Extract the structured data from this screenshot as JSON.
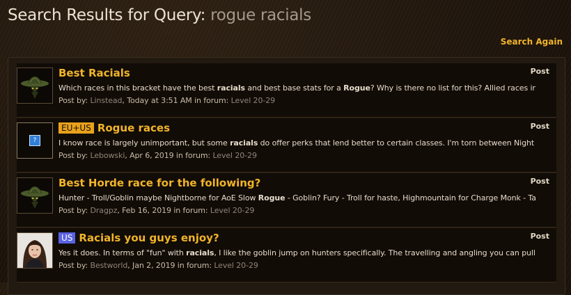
{
  "header": {
    "title_prefix": "Search Results for Query: ",
    "query": "rogue racials",
    "search_again": "Search Again"
  },
  "results": [
    {
      "badge": "",
      "title_part1": "Best ",
      "title_part2": "Racials",
      "type": "Post",
      "snippet": "Which races in this bracket have the best racials and best base stats for a Rogue? Why is there no list for this? Allied races included, horde...",
      "post_by_label": "Post by: ",
      "author": "Linstead",
      "date": ", Today at 3:51 AM in forum: ",
      "forum": "Level 20-29",
      "avatar": "troll-icon"
    },
    {
      "badge": "EU+US",
      "title_part1": "Rogue",
      "title_part2": " races",
      "type": "Post",
      "snippet": "I know race is largely unimportant, but some racials do offer perks that lend better to certain classes. I'm torn between Night Elf for Shadowmeld...",
      "post_by_label": "Post by: ",
      "author": "Lebowski",
      "date": ", Apr 6, 2019 in forum: ",
      "forum": "Level 20-29",
      "avatar": "question-icon"
    },
    {
      "badge": "",
      "title_part1": "Best Horde race for the following?",
      "title_part2": "",
      "type": "Post",
      "snippet": "Hunter - Troll/Goblin maybe Nightborne for AoE Slow Rogue - Goblin? Fury - Troll for haste, Highmountain for Charge Monk - Tauren stomp For all -...",
      "post_by_label": "Post by: ",
      "author": "Dragpz",
      "date": ", Feb 16, 2019 in forum: ",
      "forum": "Level 20-29",
      "avatar": "troll-icon"
    },
    {
      "badge": "US",
      "title_part1": "Racials",
      "title_part2": " you guys enjoy?",
      "type": "Post",
      "snippet": "Yes it does. In terms of \"fun\" with racials, I like the goblin jump on hunters specifically. The travelling and angling you can pull off is quite...",
      "post_by_label": "Post by: ",
      "author": "Bestworld",
      "date": ", Jan 2, 2019 in forum: ",
      "forum": "Level 20-29",
      "avatar": "user-photo-icon"
    }
  ],
  "colors": {
    "accent": "#f0b429",
    "background": "#1f150d",
    "badge_euus": "#e9a21b",
    "badge_us": "#5a63e4"
  }
}
